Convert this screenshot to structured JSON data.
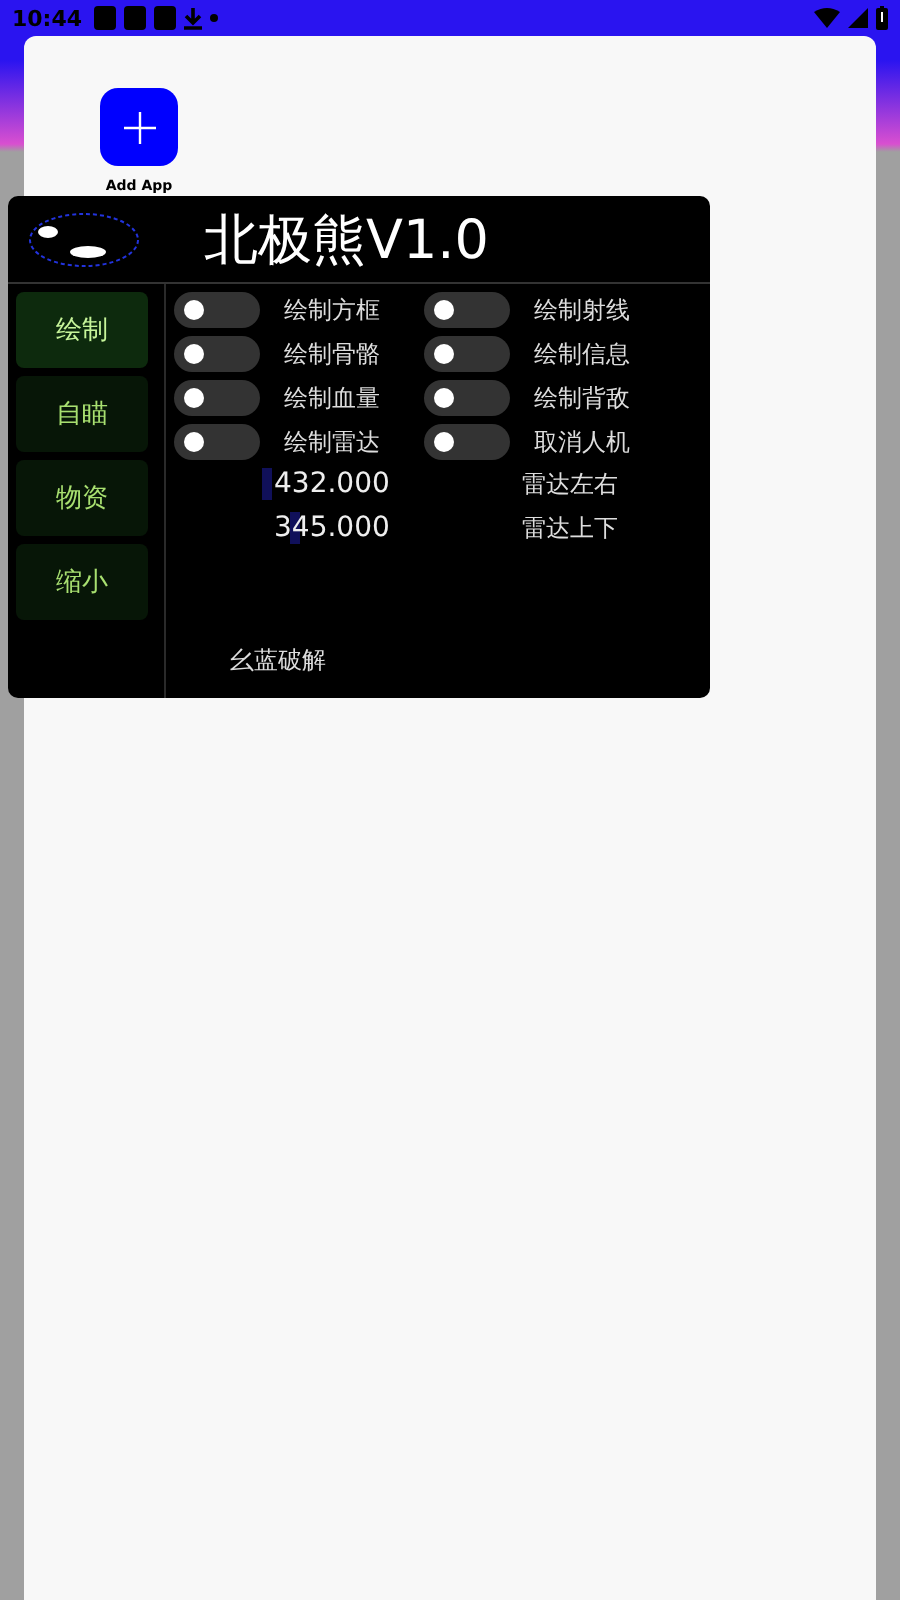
{
  "status_bar": {
    "time": "10:44"
  },
  "launcher": {
    "add_label": "Add App"
  },
  "panel": {
    "title": "北极熊V1.0",
    "tabs": [
      {
        "label": "绘制",
        "selected": true
      },
      {
        "label": "自瞄",
        "selected": false
      },
      {
        "label": "物资",
        "selected": false
      },
      {
        "label": "缩小",
        "selected": false
      }
    ],
    "toggles": [
      {
        "label": "绘制方框",
        "on": false
      },
      {
        "label": "绘制射线",
        "on": false
      },
      {
        "label": "绘制骨骼",
        "on": false
      },
      {
        "label": "绘制信息",
        "on": false
      },
      {
        "label": "绘制血量",
        "on": false
      },
      {
        "label": "绘制背敌",
        "on": false
      },
      {
        "label": "绘制雷达",
        "on": false
      },
      {
        "label": "取消人机",
        "on": false
      }
    ],
    "sliders": [
      {
        "value": "432.000",
        "label": "雷达左右"
      },
      {
        "value": "345.000",
        "label": "雷达上下"
      }
    ],
    "footer": "幺蓝破解"
  }
}
